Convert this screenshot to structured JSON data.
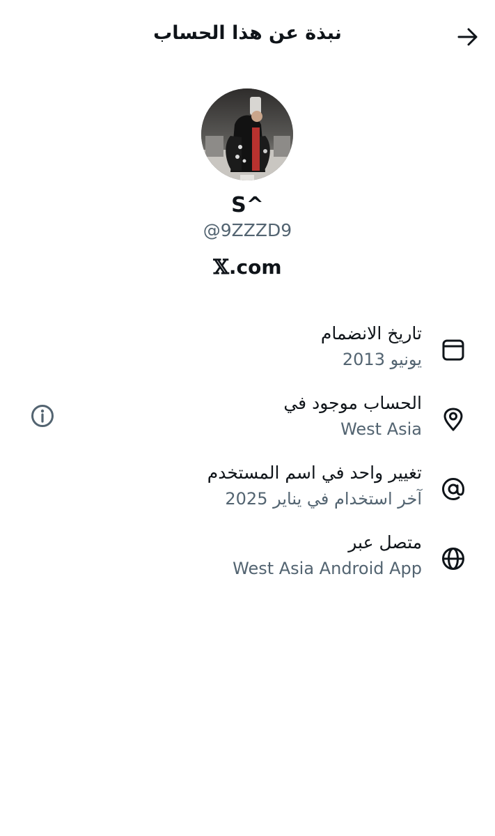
{
  "header": {
    "title": "نبذة عن هذا الحساب",
    "back_icon": "arrow-right-icon"
  },
  "profile": {
    "display_name": "S^",
    "handle": "@9ZZZD9",
    "source_logo": "𝕏",
    "source_domain": ".com"
  },
  "details": [
    {
      "icon": "calendar-icon",
      "label": "تاريخ الانضمام",
      "value": "يونيو 2013"
    },
    {
      "icon": "location-pin-icon",
      "label": "الحساب موجود في",
      "value": "West Asia",
      "info_icon": "info-icon"
    },
    {
      "icon": "at-sign-icon",
      "label": "تغيير واحد في اسم المستخدم",
      "value": "آخر استخدام في يناير 2025"
    },
    {
      "icon": "globe-icon",
      "label": "متصل عبر",
      "value": "West Asia Android App"
    }
  ],
  "colors": {
    "primary_text": "#0f1419",
    "secondary_text": "#536471",
    "background": "#ffffff"
  }
}
